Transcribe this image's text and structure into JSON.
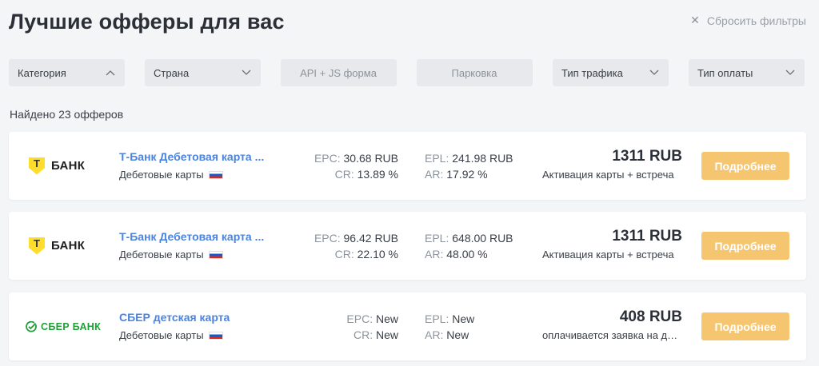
{
  "header": {
    "title": "Лучшие офферы для вас",
    "reset_label": "Сбросить фильтры",
    "reset_icon": "close-icon"
  },
  "filters": [
    {
      "label": "Категория",
      "icon": "chevron-up-icon"
    },
    {
      "label": "Страна",
      "icon": "chevron-down-icon"
    },
    {
      "label": "API + JS форма",
      "icon": ""
    },
    {
      "label": "Парковка",
      "icon": ""
    },
    {
      "label": "Тип трафика",
      "icon": "chevron-down-icon"
    },
    {
      "label": "Тип оплаты",
      "icon": "chevron-down-icon"
    }
  ],
  "found_text": "Найдено 23 офферов",
  "offers": [
    {
      "logo_text": "БАНК",
      "logo_mark": "Т",
      "name": "Т-Банк Дебетовая карта ...",
      "category": "Дебетовые карты",
      "epc_label": "EPC:",
      "epc": "30.68 RUB",
      "cr_label": "CR:",
      "cr": "13.89 %",
      "epl_label": "EPL:",
      "epl": "241.98 RUB",
      "ar_label": "AR:",
      "ar": "17.92 %",
      "price": "1311 RUB",
      "payment": "Активация карты + встреча",
      "button": "Подробнее"
    },
    {
      "logo_text": "БАНК",
      "logo_mark": "Т",
      "name": "Т-Банк Дебетовая карта ...",
      "category": "Дебетовые карты",
      "epc_label": "EPC:",
      "epc": "96.42 RUB",
      "cr_label": "CR:",
      "cr": "22.10 %",
      "epl_label": "EPL:",
      "epl": "648.00 RUB",
      "ar_label": "AR:",
      "ar": "48.00 %",
      "price": "1311 RUB",
      "payment": "Активация карты + встреча",
      "button": "Подробнее"
    },
    {
      "logo_text": "СБЕР БАНК",
      "name": "СБЕР детская карта",
      "category": "Дебетовые карты",
      "epc_label": "EPC:",
      "epc": "New",
      "cr_label": "CR:",
      "cr": "New",
      "epl_label": "EPL:",
      "epl": "New",
      "ar_label": "AR:",
      "ar": "New",
      "price": "408 RUB",
      "payment": "оплачивается заявка на дебетовую карту",
      "button": "Подробнее"
    }
  ],
  "colors": {
    "accent_link": "#4a84e0",
    "button": "#f5c66f",
    "tbank_yellow": "#ffdd2d",
    "sber_green": "#21a038"
  }
}
